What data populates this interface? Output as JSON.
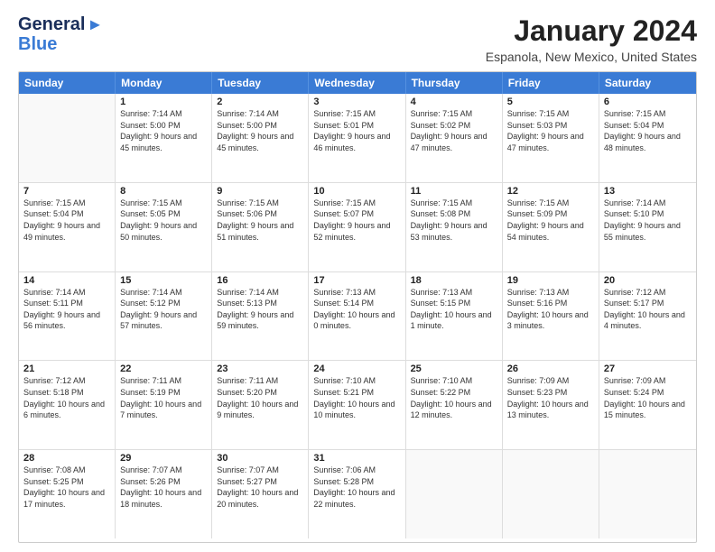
{
  "logo": {
    "part1": "General",
    "part2": "Blue"
  },
  "title": "January 2024",
  "subtitle": "Espanola, New Mexico, United States",
  "days": [
    "Sunday",
    "Monday",
    "Tuesday",
    "Wednesday",
    "Thursday",
    "Friday",
    "Saturday"
  ],
  "weeks": [
    [
      {
        "day": "",
        "empty": true
      },
      {
        "day": "1",
        "sunrise": "7:14 AM",
        "sunset": "5:00 PM",
        "daylight": "9 hours and 45 minutes."
      },
      {
        "day": "2",
        "sunrise": "7:14 AM",
        "sunset": "5:00 PM",
        "daylight": "9 hours and 45 minutes."
      },
      {
        "day": "3",
        "sunrise": "7:15 AM",
        "sunset": "5:01 PM",
        "daylight": "9 hours and 46 minutes."
      },
      {
        "day": "4",
        "sunrise": "7:15 AM",
        "sunset": "5:02 PM",
        "daylight": "9 hours and 47 minutes."
      },
      {
        "day": "5",
        "sunrise": "7:15 AM",
        "sunset": "5:03 PM",
        "daylight": "9 hours and 47 minutes."
      },
      {
        "day": "6",
        "sunrise": "7:15 AM",
        "sunset": "5:04 PM",
        "daylight": "9 hours and 48 minutes."
      }
    ],
    [
      {
        "day": "7",
        "sunrise": "7:15 AM",
        "sunset": "5:04 PM",
        "daylight": "9 hours and 49 minutes."
      },
      {
        "day": "8",
        "sunrise": "7:15 AM",
        "sunset": "5:05 PM",
        "daylight": "9 hours and 50 minutes."
      },
      {
        "day": "9",
        "sunrise": "7:15 AM",
        "sunset": "5:06 PM",
        "daylight": "9 hours and 51 minutes."
      },
      {
        "day": "10",
        "sunrise": "7:15 AM",
        "sunset": "5:07 PM",
        "daylight": "9 hours and 52 minutes."
      },
      {
        "day": "11",
        "sunrise": "7:15 AM",
        "sunset": "5:08 PM",
        "daylight": "9 hours and 53 minutes."
      },
      {
        "day": "12",
        "sunrise": "7:15 AM",
        "sunset": "5:09 PM",
        "daylight": "9 hours and 54 minutes."
      },
      {
        "day": "13",
        "sunrise": "7:14 AM",
        "sunset": "5:10 PM",
        "daylight": "9 hours and 55 minutes."
      }
    ],
    [
      {
        "day": "14",
        "sunrise": "7:14 AM",
        "sunset": "5:11 PM",
        "daylight": "9 hours and 56 minutes."
      },
      {
        "day": "15",
        "sunrise": "7:14 AM",
        "sunset": "5:12 PM",
        "daylight": "9 hours and 57 minutes."
      },
      {
        "day": "16",
        "sunrise": "7:14 AM",
        "sunset": "5:13 PM",
        "daylight": "9 hours and 59 minutes."
      },
      {
        "day": "17",
        "sunrise": "7:13 AM",
        "sunset": "5:14 PM",
        "daylight": "10 hours and 0 minutes."
      },
      {
        "day": "18",
        "sunrise": "7:13 AM",
        "sunset": "5:15 PM",
        "daylight": "10 hours and 1 minute."
      },
      {
        "day": "19",
        "sunrise": "7:13 AM",
        "sunset": "5:16 PM",
        "daylight": "10 hours and 3 minutes."
      },
      {
        "day": "20",
        "sunrise": "7:12 AM",
        "sunset": "5:17 PM",
        "daylight": "10 hours and 4 minutes."
      }
    ],
    [
      {
        "day": "21",
        "sunrise": "7:12 AM",
        "sunset": "5:18 PM",
        "daylight": "10 hours and 6 minutes."
      },
      {
        "day": "22",
        "sunrise": "7:11 AM",
        "sunset": "5:19 PM",
        "daylight": "10 hours and 7 minutes."
      },
      {
        "day": "23",
        "sunrise": "7:11 AM",
        "sunset": "5:20 PM",
        "daylight": "10 hours and 9 minutes."
      },
      {
        "day": "24",
        "sunrise": "7:10 AM",
        "sunset": "5:21 PM",
        "daylight": "10 hours and 10 minutes."
      },
      {
        "day": "25",
        "sunrise": "7:10 AM",
        "sunset": "5:22 PM",
        "daylight": "10 hours and 12 minutes."
      },
      {
        "day": "26",
        "sunrise": "7:09 AM",
        "sunset": "5:23 PM",
        "daylight": "10 hours and 13 minutes."
      },
      {
        "day": "27",
        "sunrise": "7:09 AM",
        "sunset": "5:24 PM",
        "daylight": "10 hours and 15 minutes."
      }
    ],
    [
      {
        "day": "28",
        "sunrise": "7:08 AM",
        "sunset": "5:25 PM",
        "daylight": "10 hours and 17 minutes."
      },
      {
        "day": "29",
        "sunrise": "7:07 AM",
        "sunset": "5:26 PM",
        "daylight": "10 hours and 18 minutes."
      },
      {
        "day": "30",
        "sunrise": "7:07 AM",
        "sunset": "5:27 PM",
        "daylight": "10 hours and 20 minutes."
      },
      {
        "day": "31",
        "sunrise": "7:06 AM",
        "sunset": "5:28 PM",
        "daylight": "10 hours and 22 minutes."
      },
      {
        "day": "",
        "empty": true
      },
      {
        "day": "",
        "empty": true
      },
      {
        "day": "",
        "empty": true
      }
    ]
  ]
}
